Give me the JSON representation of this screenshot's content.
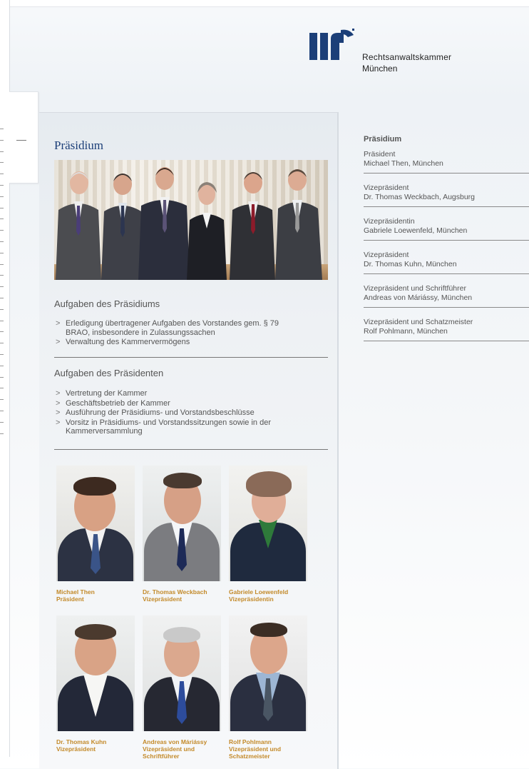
{
  "logo": {
    "line1": "Rechtsanwaltskammer",
    "line2": "München"
  },
  "panel": {
    "title": "Präsidium",
    "section1": {
      "heading": "Aufgaben des Präsidiums",
      "items": [
        "Erledigung übertragener Aufgaben des Vorstandes gem. § 79 BRAO, insbesondere in Zulassungssachen",
        "Verwaltung des Kammervermögens"
      ]
    },
    "section2": {
      "heading": "Aufgaben des Präsidenten",
      "items": [
        "Vertretung der Kammer",
        "Geschäftsbetrieb der Kammer",
        "Ausführung der Präsidiums- und Vorstandsbeschlüsse",
        "Vorsitz in Präsidiums- und Vorstandssitzungen sowie in der Kammerversammlung"
      ]
    },
    "bullet": ">",
    "portraits": [
      {
        "name": "Michael Then",
        "role": "Präsident"
      },
      {
        "name": "Dr. Thomas Weckbach",
        "role": "Vizepräsident"
      },
      {
        "name": "Gabriele Loewenfeld",
        "role": "Vizepräsidentin"
      },
      {
        "name": "Dr. Thomas Kuhn",
        "role": "Vizepräsident"
      },
      {
        "name": "Andreas von Máriássy",
        "role": "Vizepräsident und Schriftführer"
      },
      {
        "name": "Rolf Pohlmann",
        "role": "Vizepräsident und Schatzmeister"
      }
    ]
  },
  "sidebar": {
    "title": "Präsidium",
    "items": [
      {
        "role": "Präsident",
        "person": "Michael Then, München"
      },
      {
        "role": "Vizepräsident",
        "person": "Dr. Thomas Weckbach, Augsburg"
      },
      {
        "role": "Vizepräsidentin",
        "person": "Gabriele Loewenfeld, München"
      },
      {
        "role": "Vizepräsident",
        "person": "Dr. Thomas Kuhn, München"
      },
      {
        "role": "Vizepräsident und Schriftführer",
        "person": "Andreas von Máriássy, München"
      },
      {
        "role": "Vizepräsident und Schatzmeister",
        "person": "Rolf Pohlmann, München"
      }
    ]
  },
  "colors": {
    "brand_blue": "#1c3f78",
    "caption_gold": "#c38a2a"
  }
}
